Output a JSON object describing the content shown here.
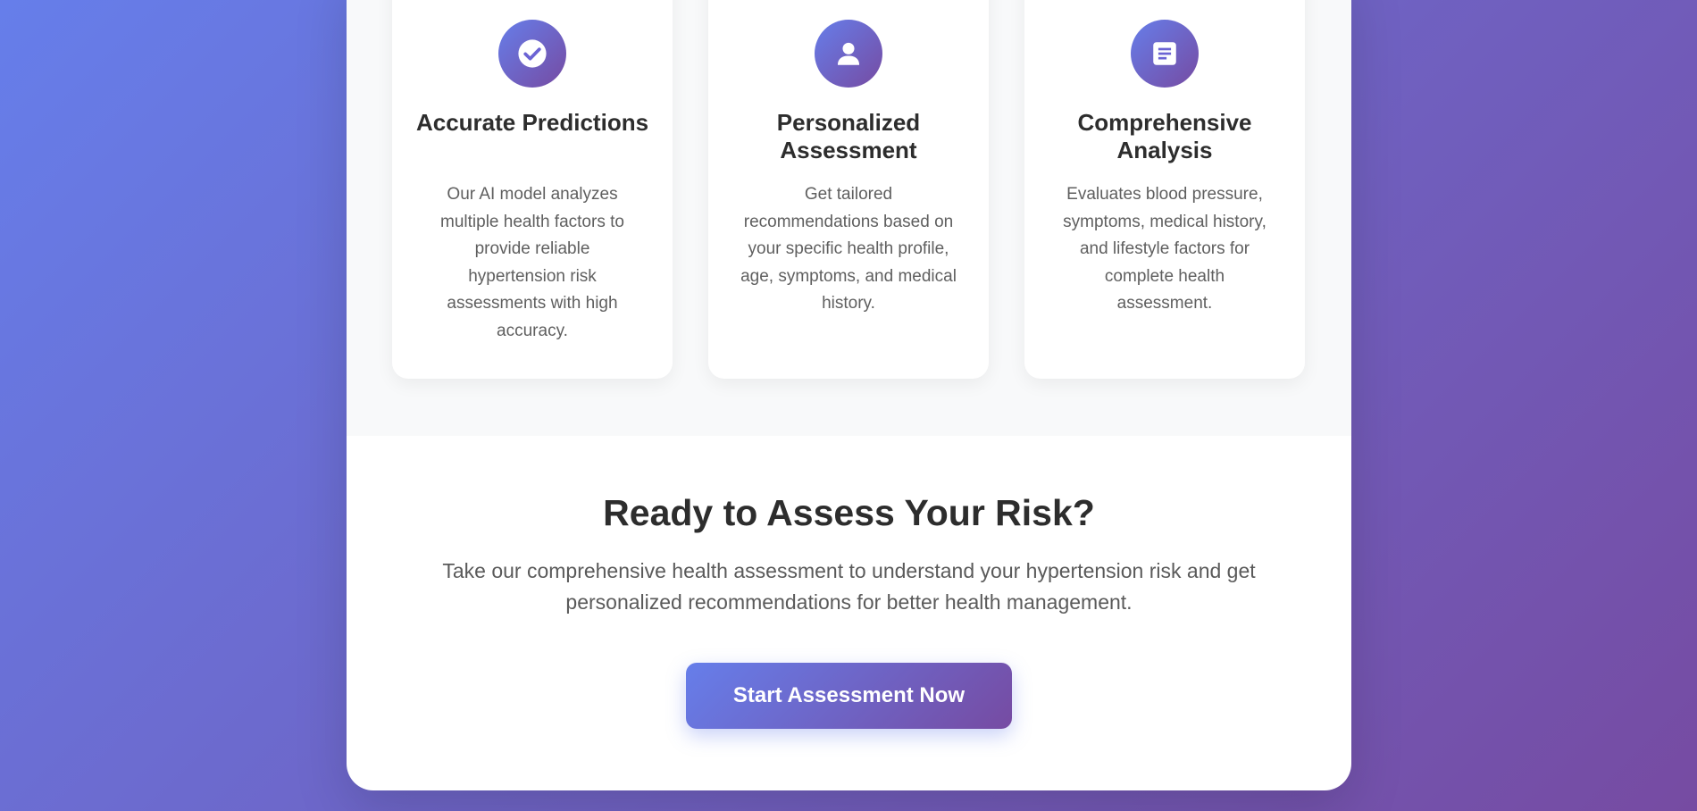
{
  "features": {
    "cards": [
      {
        "icon": "check-circle-icon",
        "title": "Accurate Predictions",
        "description": "Our AI model analyzes multiple health factors to provide reliable hypertension risk assessments with high accuracy."
      },
      {
        "icon": "user-icon",
        "title": "Personalized Assessment",
        "description": "Get tailored recommendations based on your specific health profile, age, symptoms, and medical history."
      },
      {
        "icon": "document-icon",
        "title": "Comprehensive Analysis",
        "description": "Evaluates blood pressure, symptoms, medical history, and lifestyle factors for complete health assessment."
      }
    ]
  },
  "cta": {
    "title": "Ready to Assess Your Risk?",
    "text": "Take our comprehensive health assessment to understand your hypertension risk and get personalized recommendations for better health management.",
    "button_label": "Start Assessment Now"
  },
  "colors": {
    "gradient_start": "#667eea",
    "gradient_end": "#764ba2",
    "heading": "#2d2d2d",
    "body_text": "#5f5f5f",
    "section_bg": "#f8f9fa"
  }
}
